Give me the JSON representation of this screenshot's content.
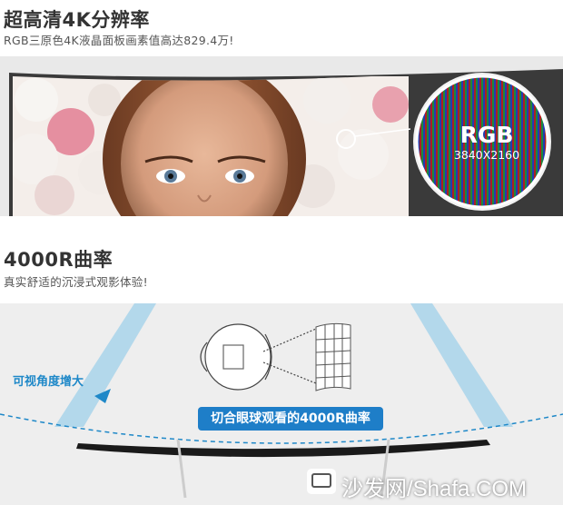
{
  "section1": {
    "title": "超高清4K分辨率",
    "subtitle": "RGB三原色4K液晶面板画素值高达829.4万!"
  },
  "rgb_callout": {
    "label": "RGB",
    "resolution": "3840X2160"
  },
  "section2": {
    "title": "4000R曲率",
    "subtitle": "真实舒适的沉浸式观影体验!",
    "fov_label": "可视角度增大",
    "badge": "切合眼球观看的4000R曲率"
  },
  "watermark": {
    "text": "沙发网/Shafa.COM"
  },
  "colors": {
    "accent_blue": "#1e7ec8",
    "fov_blue": "#a8d4ea",
    "panel_gray": "#e9e9e9"
  }
}
